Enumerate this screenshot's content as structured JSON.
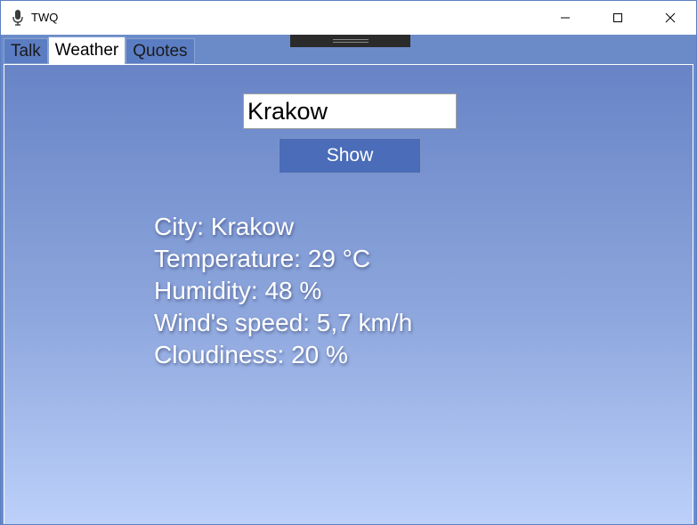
{
  "window": {
    "title": "TWQ",
    "app_icon": "microphone-icon",
    "controls": [
      "minimize-icon",
      "maximize-icon",
      "close-icon"
    ]
  },
  "tabs": [
    {
      "label": "Talk",
      "selected": false
    },
    {
      "label": "Weather",
      "selected": true
    },
    {
      "label": "Quotes",
      "selected": false
    }
  ],
  "weather": {
    "city_input_value": "Krakow",
    "show_button_label": "Show",
    "lines": {
      "city": "City: Krakow",
      "temperature": "Temperature: 29 °C",
      "humidity": "Humidity: 48 %",
      "wind_speed": "Wind's speed: 5,7 km/h",
      "cloudiness": "Cloudiness: 20 %"
    }
  },
  "colors": {
    "accent": "#4a6cb9",
    "background_top": "#6884c6",
    "background_bottom": "#bcd0fa"
  }
}
